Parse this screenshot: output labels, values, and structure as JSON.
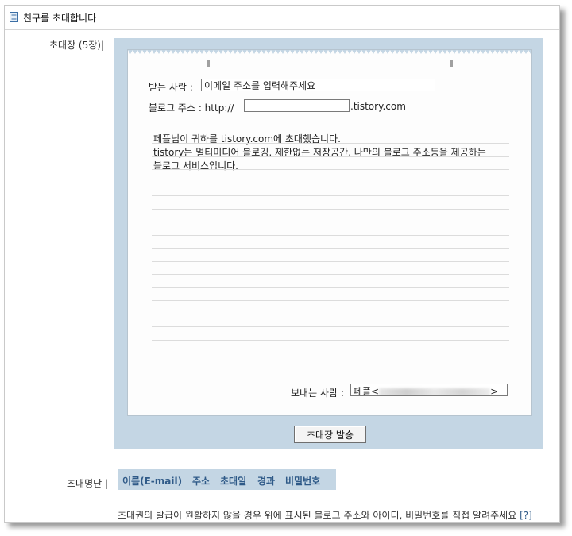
{
  "header": {
    "title": "친구를 초대합니다",
    "icon": "document-icon"
  },
  "invite_section": {
    "label": "초대장 (5장)|"
  },
  "form": {
    "recipient_label": "받는 사람 :",
    "recipient_value": "이메일 주소를 입력해주세요",
    "blog_label": "블로그 주소 : http://",
    "blog_value": "",
    "blog_suffix": ".tistory.com",
    "message_lines": [
      "페플님이 귀하를 tistory.com에 초대했습니다.",
      "tistory는 멀티미디어 블로깅, 제한없는 저장공간, 나만의 블로그 주소등을 제공하는",
      "블로그 서비스입니다."
    ],
    "sender_label": "보내는 사람 :",
    "sender_prefix": "페플<",
    "sender_suffix": ">"
  },
  "send_button": {
    "label": "초대장 발송"
  },
  "list_section": {
    "label": "초대명단 |",
    "columns": [
      "이름(E-mail)",
      "주소",
      "초대일",
      "경과",
      "비밀번호"
    ]
  },
  "footer": {
    "note": "초대권의 발급이 원활하지 않을 경우 위에 표시된 블로그 주소와 아이디, 비밀번호를 직접 알려주세요",
    "help": "[?]"
  },
  "colors": {
    "panel": "#c4d6e4",
    "link": "#2f5a88"
  }
}
